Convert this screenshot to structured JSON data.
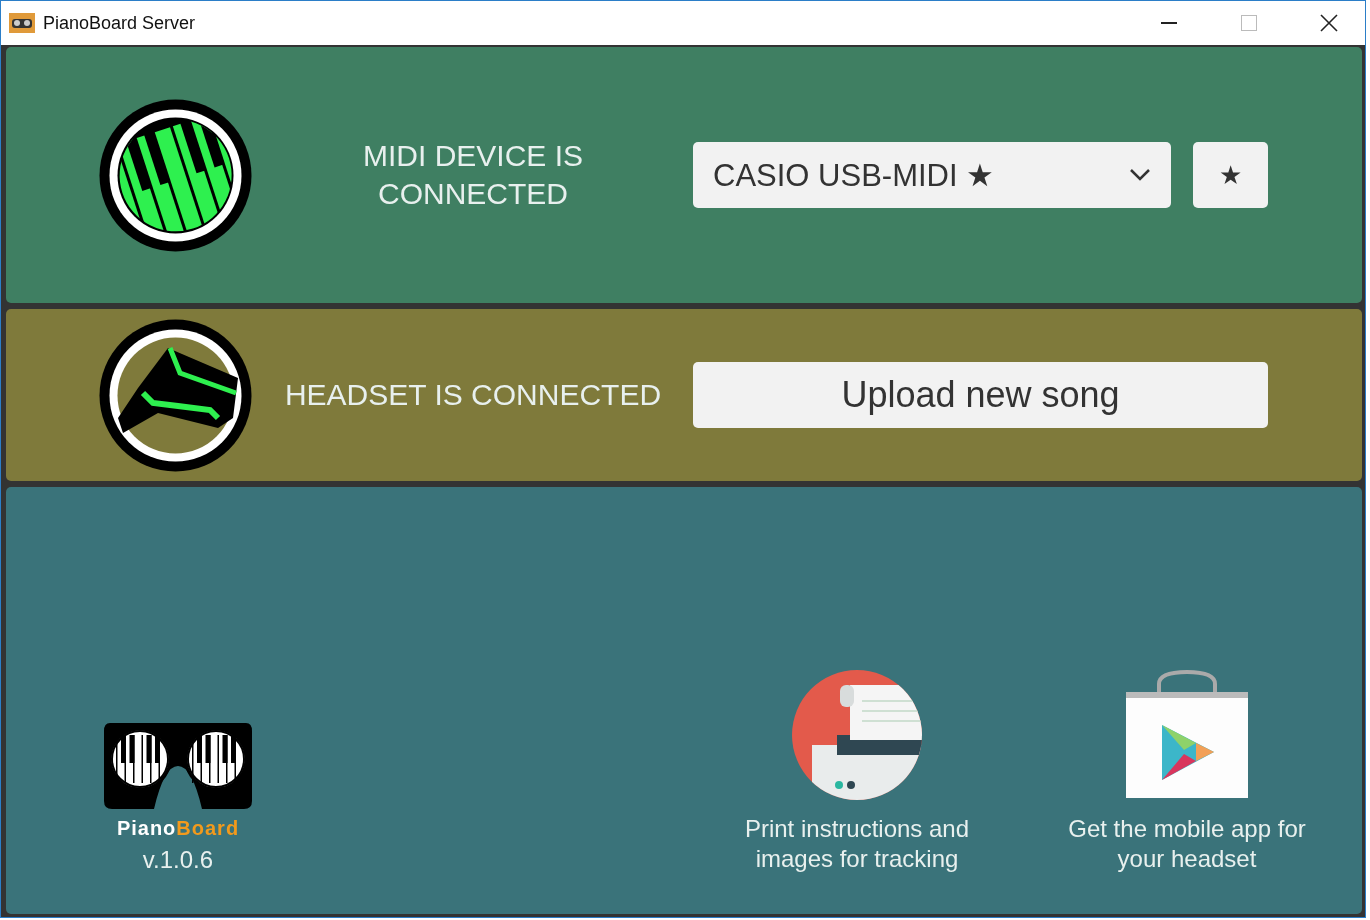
{
  "window": {
    "title": "PianoBoard Server"
  },
  "status_rows": [
    {
      "kind": "midi",
      "message": "MIDI DEVICE IS CONNECTED",
      "color": "#3f7f62",
      "device_select": {
        "value": "CASIO USB-MIDI ★"
      },
      "favorite_button": "★"
    },
    {
      "kind": "headset",
      "message": "HEADSET IS CONNECTED",
      "color": "#7f7a3b",
      "action_button": "Upload new song"
    }
  ],
  "footer": {
    "logo": {
      "wordmark_start": "Piano",
      "wordmark_end": "Board",
      "version": "v.1.0.6"
    },
    "links": [
      {
        "kind": "print",
        "label": "Print instructions and images for tracking"
      },
      {
        "kind": "store",
        "label": "Get the mobile app for your headset"
      }
    ]
  }
}
